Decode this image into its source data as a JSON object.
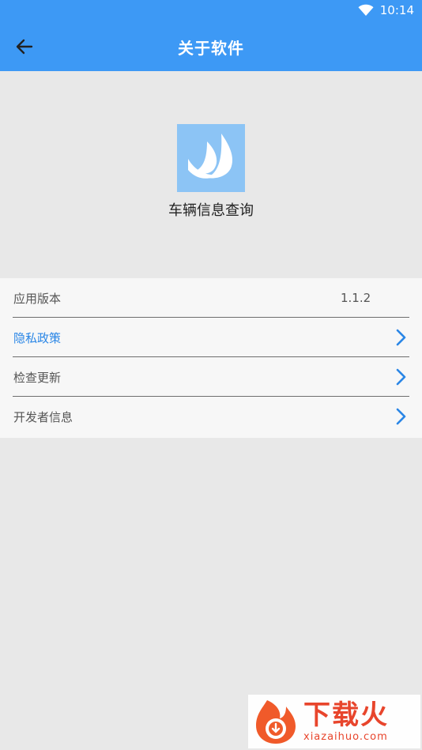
{
  "status_bar": {
    "time": "10:14"
  },
  "app_bar": {
    "title": "关于软件"
  },
  "app_info": {
    "name": "车辆信息查询"
  },
  "settings": {
    "items": [
      {
        "label": "应用版本",
        "value": "1.1.2"
      },
      {
        "label": "隐私政策"
      },
      {
        "label": "检查更新"
      },
      {
        "label": "开发者信息"
      }
    ]
  },
  "watermark": {
    "brand_cn": "下载火",
    "brand_en": "xiazaihuo.com"
  },
  "colors": {
    "primary": "#3d99f5",
    "link": "#2a86e6",
    "background": "#e8e8e8",
    "list_background": "#f7f7f7",
    "logo_background": "#8cc4f5",
    "watermark": "#e8452c"
  }
}
